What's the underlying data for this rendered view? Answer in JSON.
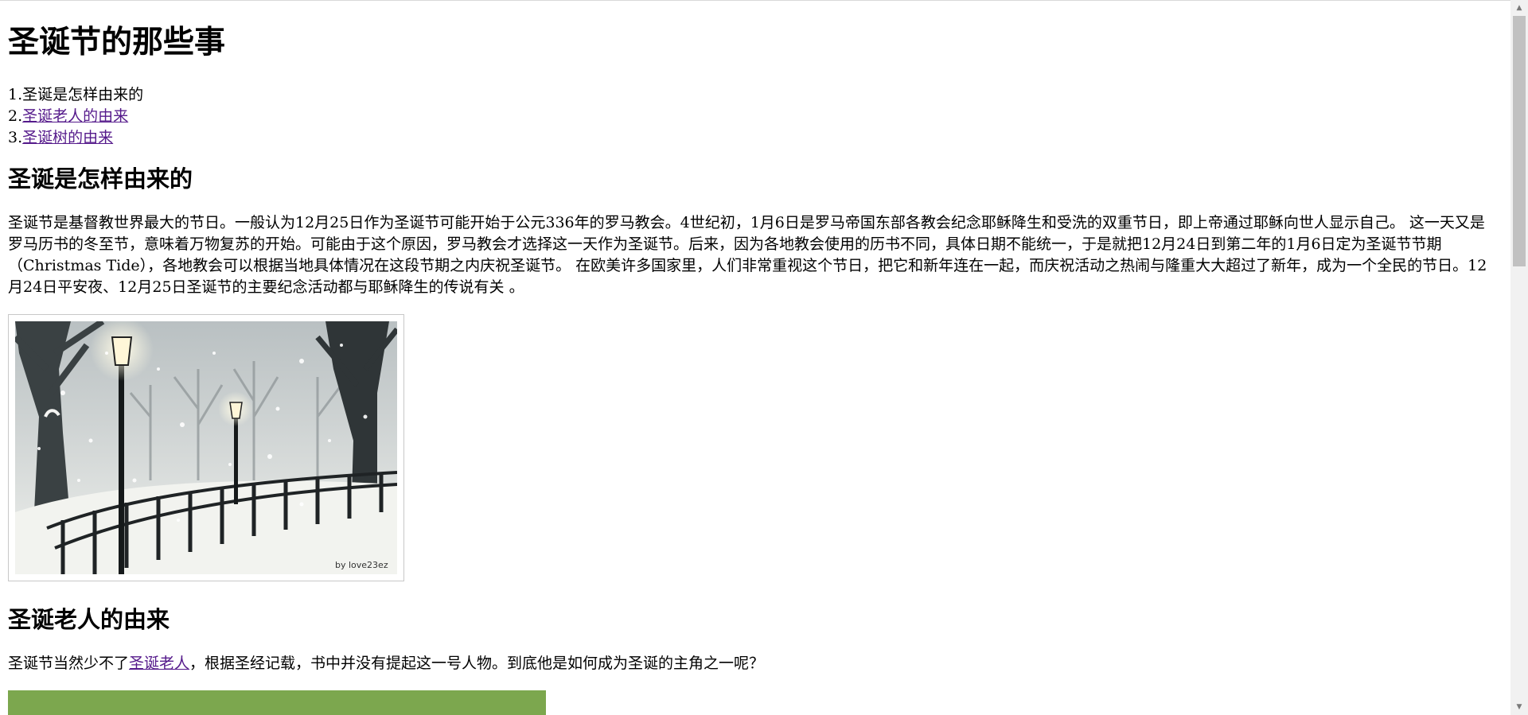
{
  "page": {
    "title": "圣诞节的那些事"
  },
  "toc": {
    "items": [
      {
        "num": "1.",
        "text": "圣诞是怎样由来的"
      },
      {
        "num": "2.",
        "text": "圣诞老人的由来"
      },
      {
        "num": "3.",
        "text": "圣诞树的由来"
      }
    ]
  },
  "section1": {
    "heading": "圣诞是怎样由来的",
    "paragraph": "圣诞节是基督教世界最大的节日。一般认为12月25日作为圣诞节可能开始于公元336年的罗马教会。4世纪初，1月6日是罗马帝国东部各教会纪念耶稣降生和受洗的双重节日，即上帝通过耶稣向世人显示自己。 这一天又是罗马历书的冬至节，意味着万物复苏的开始。可能由于这个原因，罗马教会才选择这一天作为圣诞节。后来，因为各地教会使用的历书不同，具体日期不能统一，于是就把12月24日到第二年的1月6日定为圣诞节节期（Christmas Tide），各地教会可以根据当地具体情况在这段节期之内庆祝圣诞节。 在欧美许多国家里，人们非常重视这个节日，把它和新年连在一起，而庆祝活动之热闹与隆重大大超过了新年，成为一个全民的节日。12月24日平安夜、12月25日圣诞节的主要纪念活动都与耶稣降生的传说有关 。",
    "image_watermark": "by love23ez"
  },
  "section2": {
    "heading": "圣诞老人的由来",
    "para_before": "圣诞节当然少不了",
    "para_link": "圣诞老人",
    "para_after": "，根据圣经记载，书中并没有提起这一号人物。到底他是如何成为圣诞的主角之一呢？"
  },
  "colors": {
    "visited_link": "#551a8b",
    "green_image": "#7ca74e",
    "scroll_track": "#f1f1f1",
    "scroll_thumb": "#c1c1c1"
  },
  "icons": {
    "scroll_up": "scroll-up-arrow-icon",
    "scroll_down": "scroll-down-arrow-icon"
  }
}
